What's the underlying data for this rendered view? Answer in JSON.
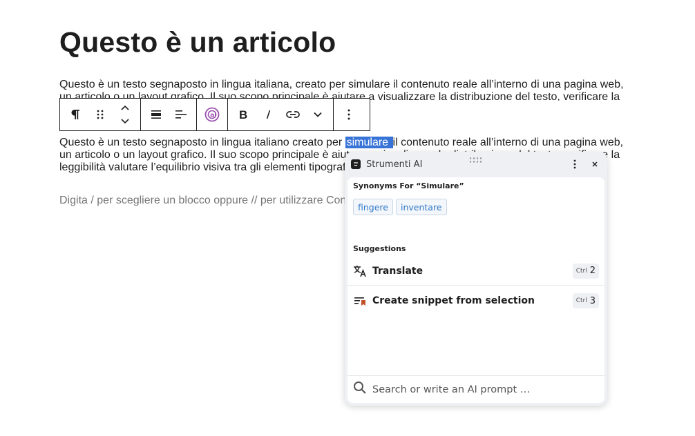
{
  "article": {
    "title": "Questo è un articolo",
    "para1": [
      "Questo è un testo segnaposto in lingua italiana, creato per simulare il contenuto reale all’interno di una pagina web,",
      "un articolo o un layout grafico. Il suo scopo principale è aiutare a visualizzare la distribuzione del testo, verificare la"
    ],
    "para2_line1_before": "Questo è un testo segnaposto in lingua italiano creato per ",
    "para2_selected": "simulare ",
    "para2_line1_after": "il contenuto reale all’interno di una pagina web,",
    "para2_line2": "un articolo o un layout grafico. Il suo scopo principale è aiutare a visualizzare la distribuzione del testo, verificare la",
    "para2_line3": "leggibilità  valutare l’equilibrio visiva tra gli elementi tipografici",
    "placeholder": "Digita / per scegliere un blocco oppure // per utilizzare Content AI"
  },
  "toolbar": {
    "icons": [
      "paragraph-icon",
      "drag-handle-icon",
      "move-up-down-icon",
      "align-icon",
      "justify-icon",
      "content-ai-icon",
      "bold-icon",
      "italic-icon",
      "link-icon",
      "more-chevron-icon",
      "options-icon"
    ]
  },
  "ai_panel": {
    "title": "Strumenti AI",
    "synonyms_heading": "Synonyms For “Simulare”",
    "synonyms": [
      "fingere",
      "inventare"
    ],
    "suggestions_heading": "Suggestions",
    "suggestions": [
      {
        "label": "Translate",
        "modifier": "Ctrl",
        "key": "2",
        "icon": "translate-icon"
      },
      {
        "label": "Create snippet from selection",
        "modifier": "Ctrl",
        "key": "3",
        "icon": "snippet-icon"
      }
    ],
    "search_placeholder": "Search or write an AI prompt …"
  },
  "colors": {
    "selection": "#3874d8",
    "chip_text": "#2f78c8",
    "ai_brand": "#9b4fb0",
    "snippet_accent": "#c0522a"
  }
}
